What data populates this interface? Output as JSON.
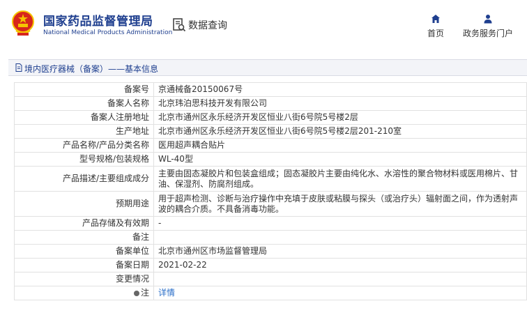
{
  "header": {
    "brand_cn": "国家药品监督管理局",
    "brand_en": "National Medical Products Administration",
    "query_label": "数据查询",
    "nav": [
      {
        "label": "首页",
        "icon": "home-icon"
      },
      {
        "label": "政务服务门户",
        "icon": "user-icon"
      }
    ]
  },
  "breadcrumb": {
    "icon": "document-icon",
    "text": "境内医疗器械（备案）——基本信息"
  },
  "details": {
    "rows": [
      {
        "key": "备案号",
        "value": "京通械备20150067号"
      },
      {
        "key": "备案人名称",
        "value": "北京玮泊思科技开发有限公司"
      },
      {
        "key": "备案人注册地址",
        "value": "北京市通州区永乐经济开发区恒业八街6号院5号楼2层"
      },
      {
        "key": "生产地址",
        "value": "北京市通州区永乐经济开发区恒业八街6号院5号楼2层201-210室"
      },
      {
        "key": "产品名称/产品分类名称",
        "value": "医用超声耦合贴片"
      },
      {
        "key": "型号规格/包装规格",
        "value": "WL-40型"
      },
      {
        "key": "产品描述/主要组成成分",
        "value": "主要由固态凝胶片和包装盒组成；固态凝胶片主要由纯化水、水溶性的聚合物材料或医用棉片、甘油、保湿剂、防腐剂组成。"
      },
      {
        "key": "预期用途",
        "value": "用于超声检测、诊断与治疗操作中充填于皮肤或粘膜与探头（或治疗头）辐射面之间，作为透射声波的耦合介质。不具备消毒功能。"
      },
      {
        "key": "产品存储及有效期",
        "value": "-"
      },
      {
        "key": "备注",
        "value": ""
      },
      {
        "key": "备案单位",
        "value": "北京市通州区市场监督管理局"
      },
      {
        "key": "备案日期",
        "value": "2021-02-22"
      },
      {
        "key": "变更情况",
        "value": ""
      },
      {
        "key": "注",
        "value": "详情",
        "icon": "pin-icon"
      }
    ]
  },
  "colors": {
    "brand": "#1f3f8f",
    "link": "#2a6ec8",
    "logo_red": "#d7261c",
    "logo_gold": "#f5c400"
  }
}
